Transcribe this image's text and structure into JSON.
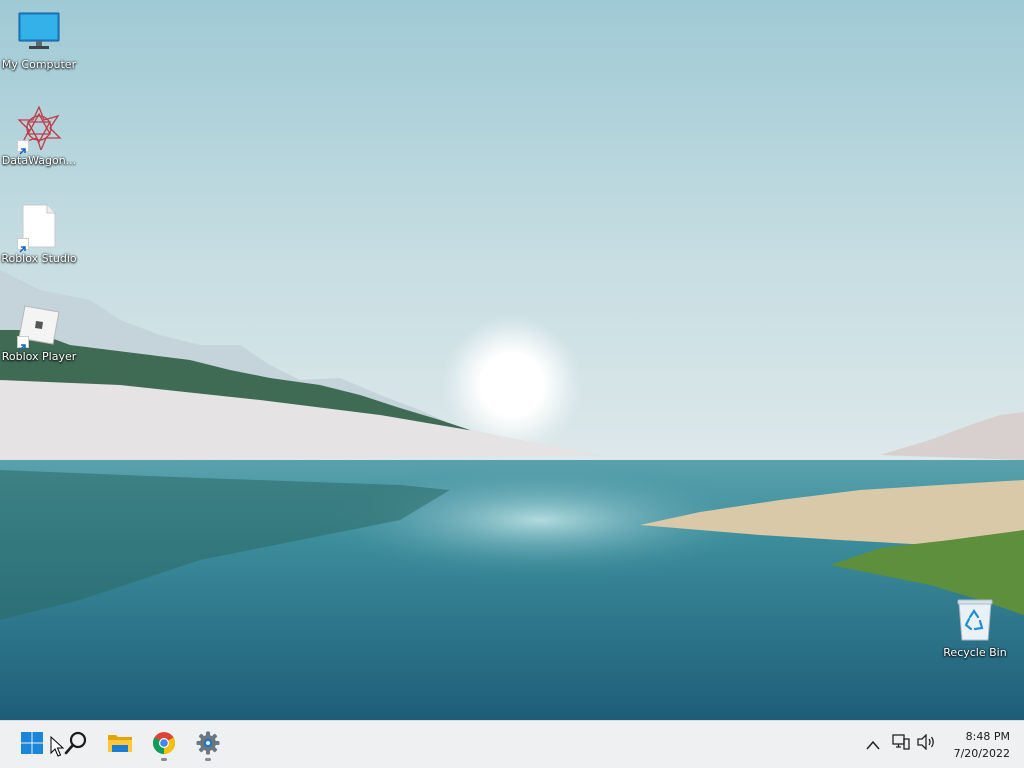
{
  "desktop": {
    "icons": [
      {
        "label": "My Computer",
        "icon": "monitor-icon"
      },
      {
        "label": "DataWagon...",
        "icon": "datawagon-logo-icon"
      },
      {
        "label": "Roblox Studio",
        "icon": "blank-file-icon"
      },
      {
        "label": "Roblox Player",
        "icon": "roblox-logo-icon"
      },
      {
        "label": "Recycle Bin",
        "icon": "recycle-bin-icon"
      }
    ]
  },
  "taskbar": {
    "pinned": [
      {
        "name": "start",
        "icon": "windows-logo-icon"
      },
      {
        "name": "search",
        "icon": "search-icon"
      },
      {
        "name": "file-explorer",
        "icon": "folder-icon"
      },
      {
        "name": "chrome",
        "icon": "chrome-icon"
      },
      {
        "name": "settings",
        "icon": "gear-icon"
      }
    ],
    "tray": {
      "icons": [
        "chevron-up-icon",
        "network-icon",
        "volume-icon"
      ],
      "time": "8:48 PM",
      "date": "7/20/2022"
    }
  },
  "colors": {
    "taskbar_bg": "#eef0f2",
    "windows_blue": "#0078d4"
  }
}
